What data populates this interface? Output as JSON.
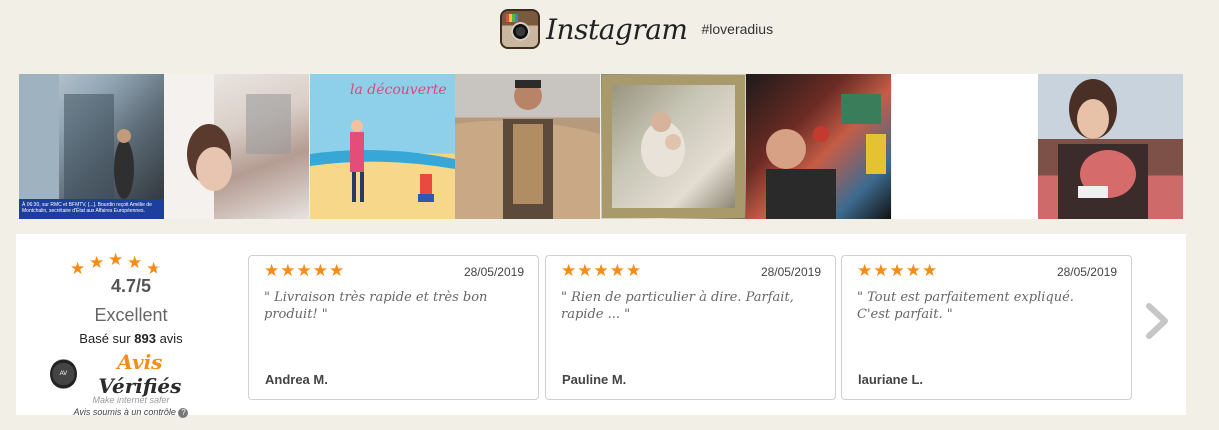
{
  "instagram": {
    "title": "Instagram",
    "hashtag": "#loveradius"
  },
  "photos": [
    {
      "name": "photo-store-window",
      "caption": "À 06:30, sur RMC et BFMTV, [...]. Bourdin reçoit Amélie de Montchalin, secrétaire d'État aux Affaires Européennes."
    },
    {
      "name": "photo-mother-baby-carrier"
    },
    {
      "name": "photo-illustration-beach",
      "title": "la découverte"
    },
    {
      "name": "photo-father-desert"
    },
    {
      "name": "photo-framed-mother-baby"
    },
    {
      "name": "photo-child-market"
    },
    {
      "name": "photo-blank"
    },
    {
      "name": "photo-girl-doll"
    }
  ],
  "summary": {
    "rating_value": 4.7,
    "score": "4.7/5",
    "label": "Excellent",
    "based_prefix": "Basé sur",
    "review_count": "893",
    "based_suffix": "avis",
    "brand_part1": "Avis",
    "brand_part2": "Vérifiés",
    "slogan": "Make internet safer",
    "note": "Avis soumis à un contrôle"
  },
  "reviews": [
    {
      "stars": "★★★★★",
      "date": "28/05/2019",
      "text": "\" Livraison très rapide et très bon produit! \"",
      "author": "Andrea M."
    },
    {
      "stars": "★★★★★",
      "date": "28/05/2019",
      "text": "\" Rien de particulier à dire. Parfait, rapide ... \"",
      "author": "Pauline M."
    },
    {
      "stars": "★★★★★",
      "date": "28/05/2019",
      "text": "\" Tout est parfaitement expliqué. C'est parfait. \"",
      "author": "lauriane L."
    }
  ],
  "colors": {
    "star": "#f48c16",
    "background": "#f2efe7"
  },
  "icons": {
    "logo": "instagram-camera-icon",
    "next": "chevron-right-icon",
    "help": "question-circle-icon"
  }
}
